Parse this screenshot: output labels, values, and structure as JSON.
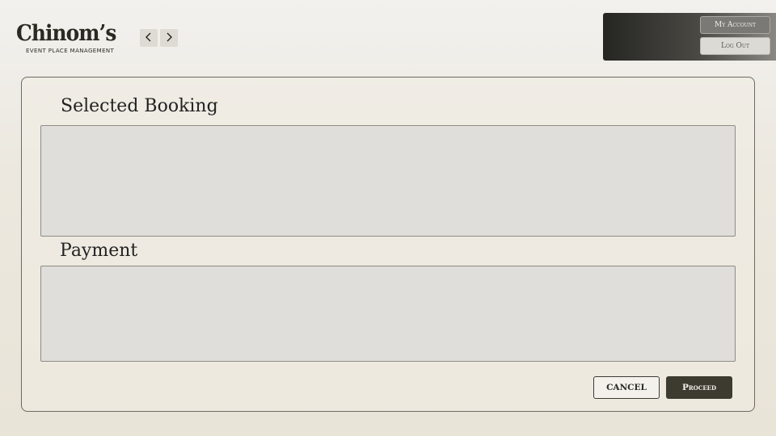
{
  "header": {
    "logo_title": "Chinom’s",
    "logo_subtitle": "EVENT PLACE MANAGEMENT",
    "nav_back_icon": "chevron-left-icon",
    "nav_forward_icon": "chevron-right-icon"
  },
  "account": {
    "my_account_label": "My Account",
    "log_out_label": "Log Out"
  },
  "main": {
    "selected_booking_title": "Selected Booking",
    "payment_title": "Payment",
    "cancel_label": "CANCEL",
    "proceed_label": "Proceed"
  },
  "colors": {
    "primary_dark": "#3d3b2f",
    "panel_fill": "#dfdeda",
    "background": "#ece8df"
  }
}
